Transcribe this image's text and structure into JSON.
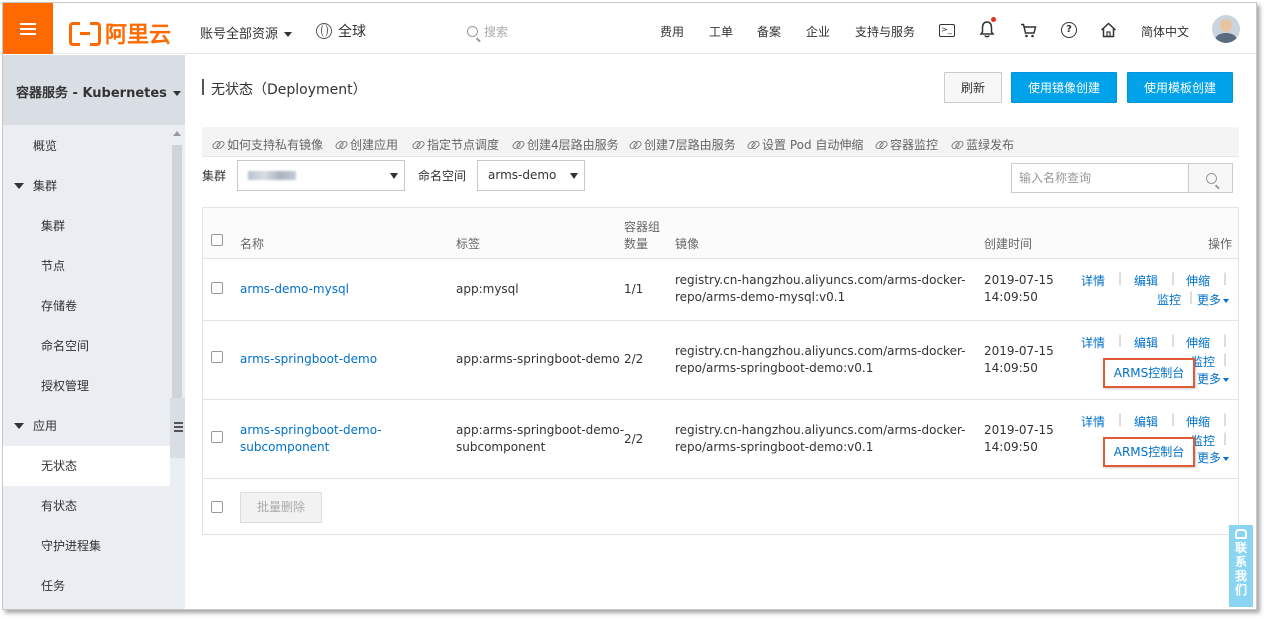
{
  "topbar": {
    "brand": "阿里云",
    "resource_scope": "账号全部资源",
    "region": "全球",
    "search_placeholder": "搜索",
    "nav": [
      "费用",
      "工单",
      "备案",
      "企业",
      "支持与服务"
    ],
    "language": "简体中文",
    "terminal_glyph": ">_",
    "help_glyph": "?"
  },
  "sidebar": {
    "title": "容器服务 - Kubernetes",
    "overview": "概览",
    "group_cluster": "集群",
    "cluster_items": [
      "集群",
      "节点",
      "存储卷",
      "命名空间",
      "授权管理"
    ],
    "group_app": "应用",
    "app_items": [
      "无状态",
      "有状态",
      "守护进程集",
      "任务"
    ],
    "active_item": "无状态"
  },
  "page": {
    "title": "无状态（Deployment）",
    "refresh_button": "刷新",
    "create_from_image_button": "使用镜像创建",
    "create_from_template_button": "使用模板创建"
  },
  "help_links": [
    "如何支持私有镜像",
    "创建应用",
    "指定节点调度",
    "创建4层路由服务",
    "创建7层路由服务",
    "设置 Pod 自动伸缩",
    "容器监控",
    "蓝绿发布"
  ],
  "filters": {
    "cluster_label": "集群",
    "namespace_label": "命名空间",
    "namespace_value": "arms-demo",
    "search_placeholder": "输入名称查询"
  },
  "table": {
    "headers": {
      "name": "名称",
      "labels": "标签",
      "pods_line1": "容器组",
      "pods_line2": "数量",
      "image": "镜像",
      "created": "创建时间",
      "actions": "操作"
    },
    "rows": [
      {
        "name": "arms-demo-mysql",
        "name_line2": "",
        "label": "app:mysql",
        "label_line2": "",
        "pods": "1/1",
        "image_line1": "registry.cn-hangzhou.aliyuncs.com/arms-docker-",
        "image_line2": "repo/arms-demo-mysql:v0.1",
        "created_date": "2019-07-15",
        "created_time": "14:09:50"
      },
      {
        "name": "arms-springboot-demo",
        "name_line2": "",
        "label": "app:arms-springboot-demo",
        "label_line2": "",
        "pods": "2/2",
        "image_line1": "registry.cn-hangzhou.aliyuncs.com/arms-docker-",
        "image_line2": "repo/arms-springboot-demo:v0.1",
        "created_date": "2019-07-15",
        "created_time": "14:09:50"
      },
      {
        "name": "arms-springboot-demo-",
        "name_line2": "subcomponent",
        "label": "app:arms-springboot-demo-",
        "label_line2": "subcomponent",
        "pods": "2/2",
        "image_line1": "registry.cn-hangzhou.aliyuncs.com/arms-docker-",
        "image_line2": "repo/arms-springboot-demo:v0.1",
        "created_date": "2019-07-15",
        "created_time": "14:09:50"
      }
    ],
    "actions": {
      "details": "详情",
      "edit": "编辑",
      "scale": "伸缩",
      "monitor": "监控",
      "more": "更多",
      "arms_console": "ARMS控制台",
      "separator": "|"
    },
    "batch_delete": "批量删除"
  },
  "contact_us": "联系我们",
  "colors": {
    "brand_orange": "#ff6a00",
    "primary_blue": "#00a2ea",
    "link_blue": "#0070cc",
    "highlight_red": "#e05a35"
  }
}
